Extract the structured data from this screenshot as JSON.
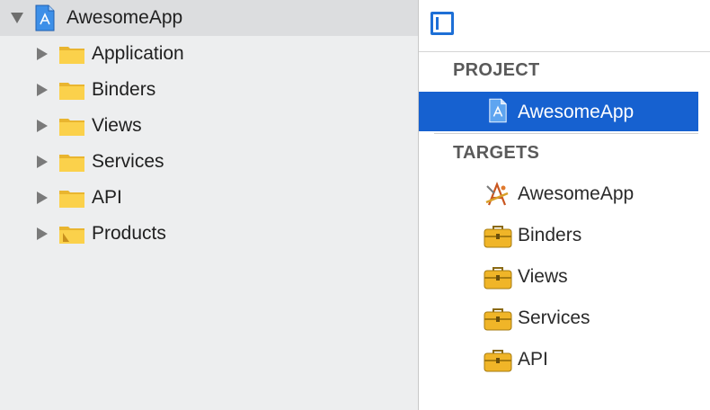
{
  "navigator": {
    "root": {
      "label": "AwesomeApp",
      "icon": "xcode-project-icon"
    },
    "groups": [
      {
        "label": "Application",
        "icon": "folder-icon"
      },
      {
        "label": "Binders",
        "icon": "folder-icon"
      },
      {
        "label": "Views",
        "icon": "folder-icon"
      },
      {
        "label": "Services",
        "icon": "folder-icon"
      },
      {
        "label": "API",
        "icon": "folder-icon"
      },
      {
        "label": "Products",
        "icon": "products-folder-icon"
      }
    ]
  },
  "editor": {
    "project_header": "PROJECT",
    "project": {
      "label": "AwesomeApp",
      "icon": "xcode-project-icon"
    },
    "targets_header": "TARGETS",
    "targets": [
      {
        "label": "AwesomeApp",
        "icon": "app-target-icon"
      },
      {
        "label": "Binders",
        "icon": "framework-toolbox-icon"
      },
      {
        "label": "Views",
        "icon": "framework-toolbox-icon"
      },
      {
        "label": "Services",
        "icon": "framework-toolbox-icon"
      },
      {
        "label": "API",
        "icon": "framework-toolbox-icon"
      }
    ]
  },
  "colors": {
    "selection": "#1661d0",
    "accent": "#1d6fd6",
    "folder": "#f7c948"
  }
}
